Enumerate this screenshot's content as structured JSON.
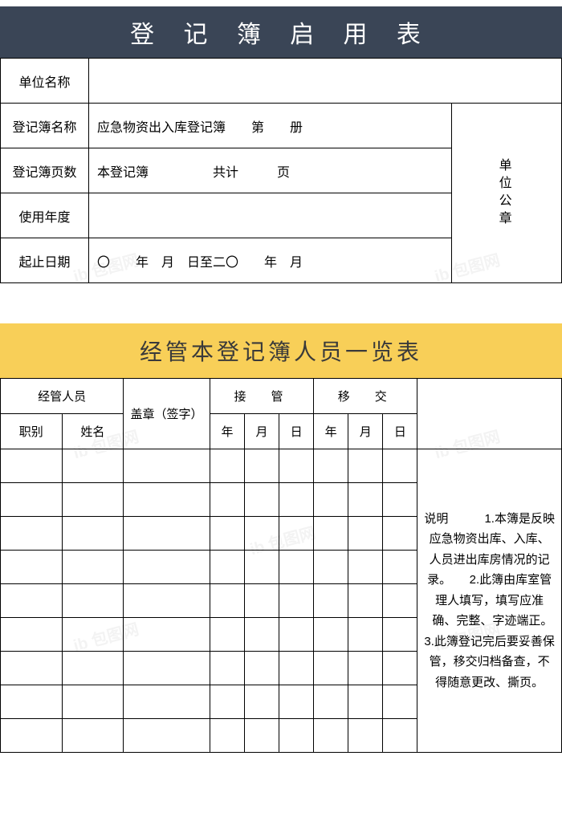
{
  "header": {
    "title": "登 记 簿 启 用 表"
  },
  "top_form": {
    "rows": {
      "unit_name": {
        "label": "单位名称",
        "value": ""
      },
      "register_name": {
        "label": "登记簿名称",
        "value": "应急物资出入库登记簿　　第　　册"
      },
      "page_count": {
        "label": "登记簿页数",
        "value": "本登记簿　　　　　共计　　　页"
      },
      "year": {
        "label": "使用年度",
        "value": ""
      },
      "date_range": {
        "label": "起止日期",
        "value": "〇　　年　月　日至二〇　　年　月"
      }
    },
    "seal_label": "单位公章"
  },
  "staff_header": {
    "title": "经管本登记簿人员一览表"
  },
  "staff_table": {
    "head": {
      "manager": "经管人员",
      "seal": "盖章（签字）",
      "takeover": "接　管",
      "handover": "移　交",
      "role": "职别",
      "name": "姓名",
      "year": "年",
      "month": "月",
      "day": "日"
    },
    "notes_label": "说明",
    "notes": "1.本簿是反映应急物资出库、入库、人员进出库房情况的记录。　　2.此簿由库室管理人填写，填写应准确、完整、字迹端正。　3.此簿登记完后要妥善保管，移交归档备查，不得随意更改、撕页。"
  }
}
